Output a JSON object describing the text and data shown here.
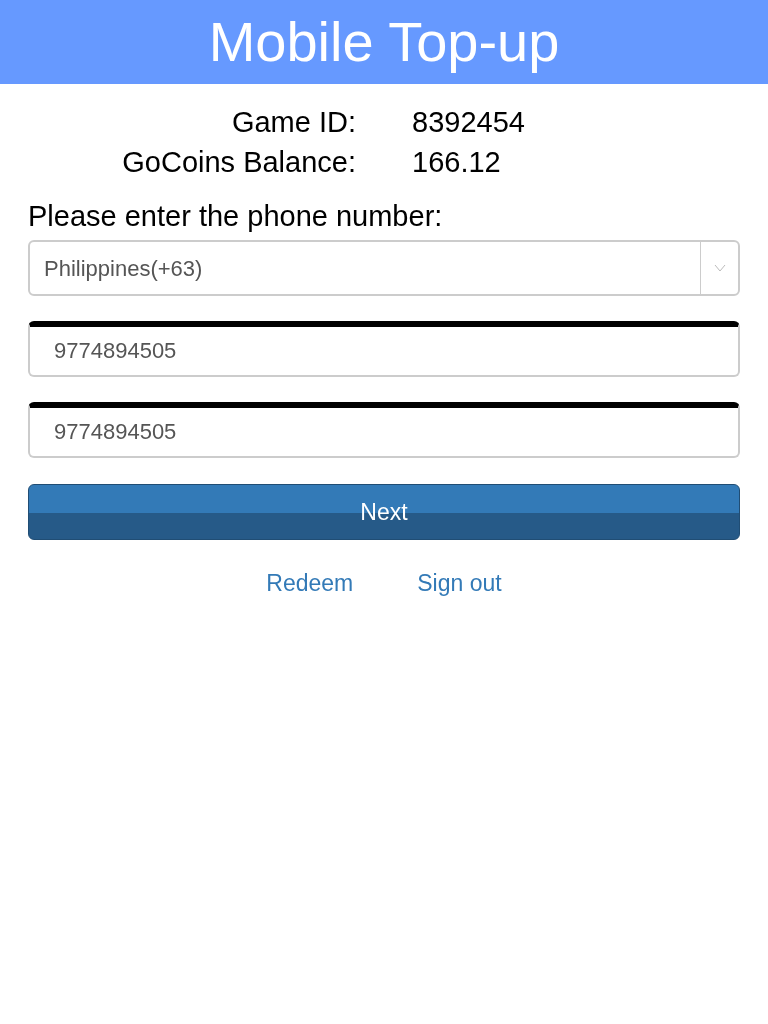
{
  "header": {
    "title": "Mobile Top-up"
  },
  "info": [
    {
      "label": "Game ID:",
      "value": "8392454"
    },
    {
      "label": "GoCoins Balance:",
      "value": "166.12"
    }
  ],
  "prompt": "Please enter the phone number:",
  "country_select": {
    "value": "Philippines(+63)"
  },
  "phone_fields": [
    {
      "value": "9774894505"
    },
    {
      "value": "9774894505"
    }
  ],
  "next_button": "Next",
  "links": [
    "Redeem",
    "Sign out"
  ]
}
